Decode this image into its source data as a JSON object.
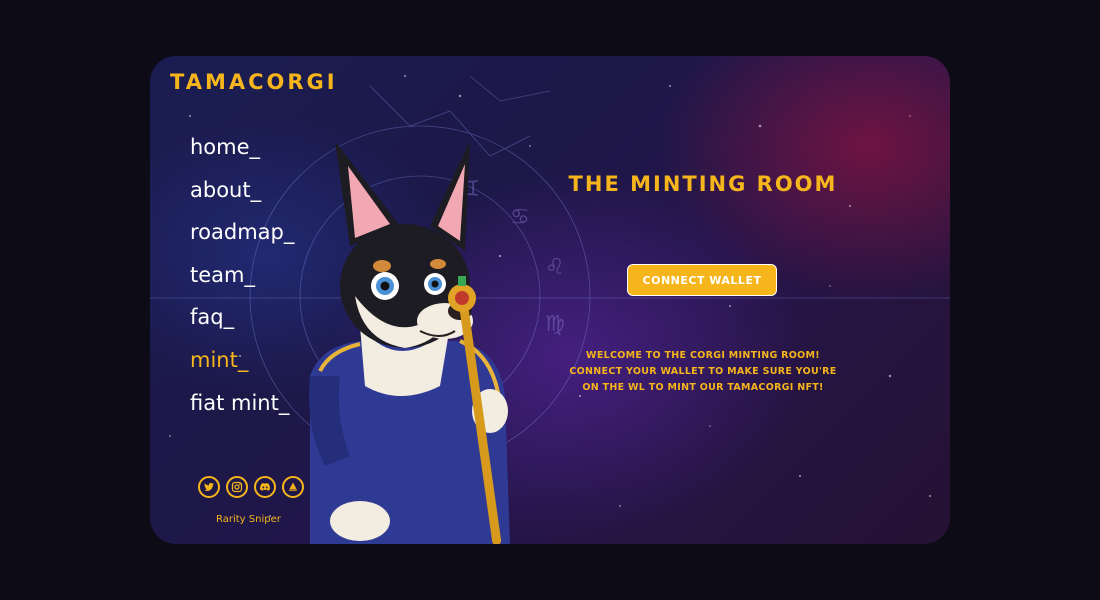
{
  "brand": {
    "logo_text": "TAMACORGI",
    "accent_color": "#f5b51b"
  },
  "nav": {
    "items": [
      {
        "label": "home_"
      },
      {
        "label": "about_"
      },
      {
        "label": "roadmap_"
      },
      {
        "label": "team_"
      },
      {
        "label": "faq_"
      },
      {
        "label": "mint_",
        "active": true
      },
      {
        "label": "fiat mint_"
      }
    ]
  },
  "socials": {
    "icons": [
      "twitter-icon",
      "instagram-icon",
      "discord-icon",
      "opensea-icon"
    ],
    "rarity_link": "Rarity Sniper"
  },
  "main": {
    "title": "THE MINTING ROOM",
    "connect_button": "CONNECT WALLET",
    "welcome_lines": [
      "WELCOME TO THE CORGI MINTING ROOM!",
      "CONNECT YOUR WALLET TO MAKE SURE YOU'RE",
      "ON THE WL TO MINT OUR TAMACORGI NFT!"
    ]
  }
}
